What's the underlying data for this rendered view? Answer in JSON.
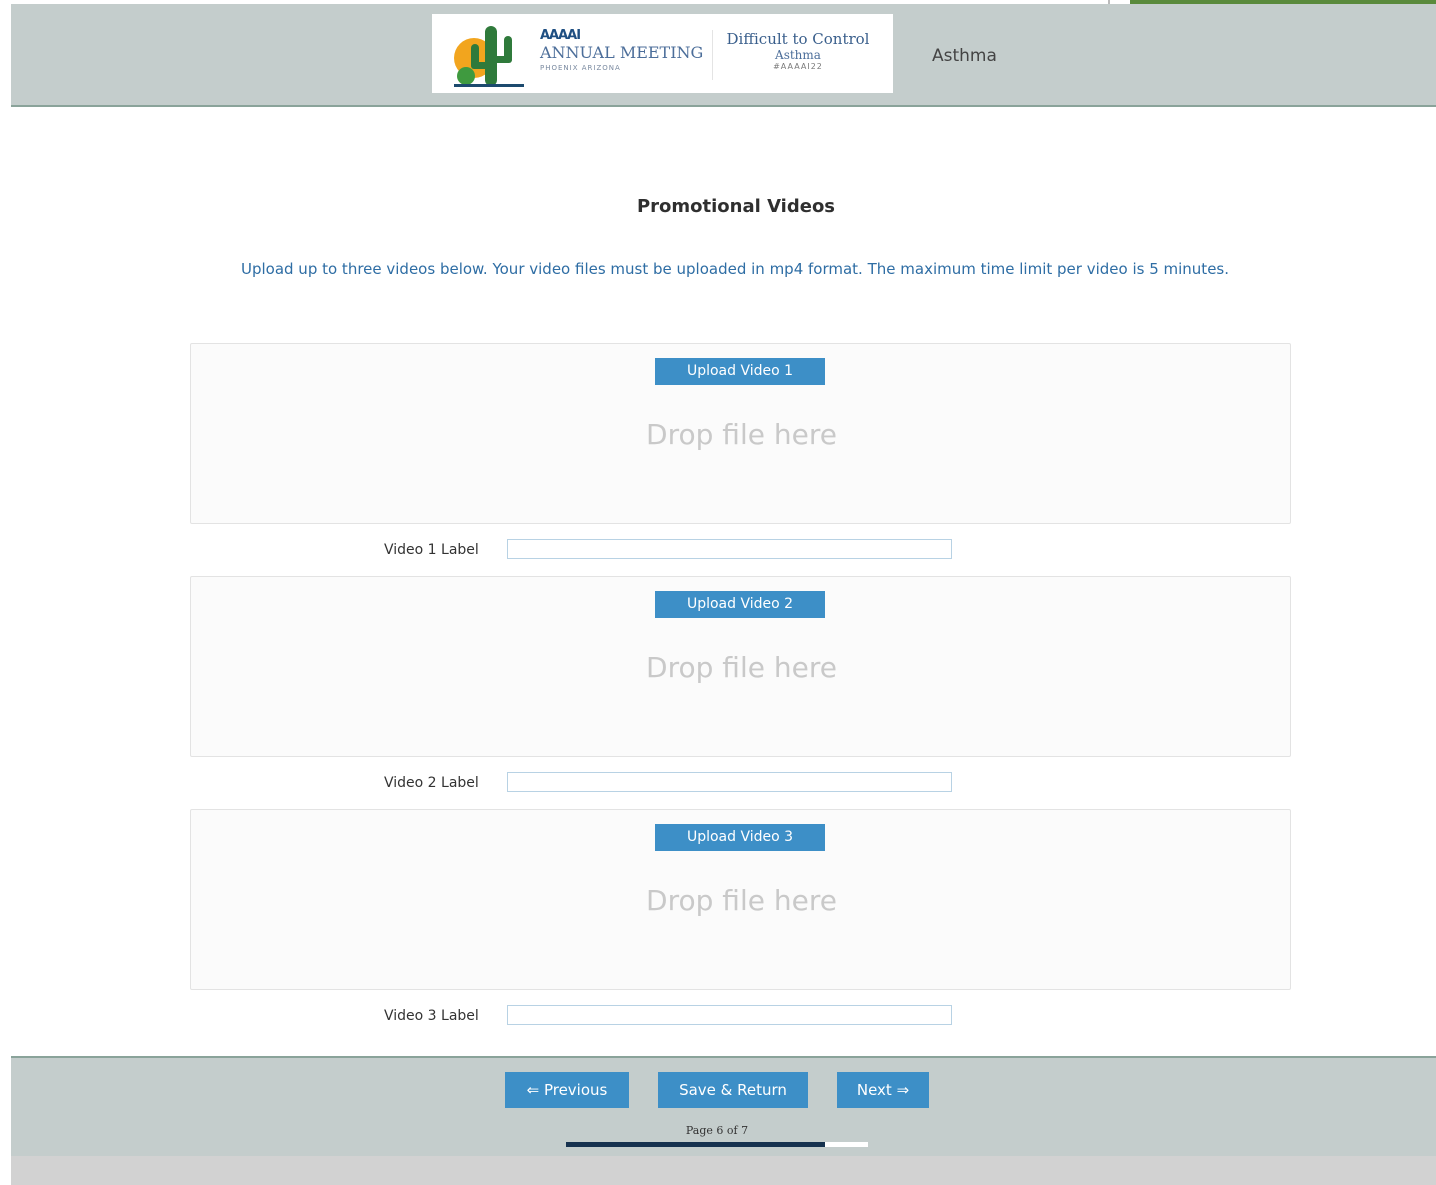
{
  "header": {
    "logo": {
      "org": "AAAAI",
      "meeting": "ANNUAL MEETING",
      "tagline": "PHOENIX ARIZONA",
      "event_line1": "Difficult to Control",
      "event_line2": "Asthma",
      "event_line3": "#AAAAI22"
    },
    "title": "Asthma"
  },
  "main": {
    "title": "Promotional Videos",
    "instructions": "Upload up to three videos below. Your video files must be uploaded in mp4 format. The maximum time limit per video is 5 minutes.",
    "uploads": [
      {
        "button": "Upload Video 1",
        "drop_text": "Drop file here",
        "label": "Video 1 Label",
        "value": ""
      },
      {
        "button": "Upload Video 2",
        "drop_text": "Drop file here",
        "label": "Video 2 Label",
        "value": ""
      },
      {
        "button": "Upload Video 3",
        "drop_text": "Drop file here",
        "label": "Video 3 Label",
        "value": ""
      }
    ]
  },
  "footer": {
    "prev": "⇐ Previous",
    "save": "Save & Return",
    "next": "Next ⇒",
    "page_indicator": "Page 6 of 7",
    "progress": 0.857
  },
  "colors": {
    "header_bg": "#c4cdcc",
    "button": "#3d8fc7",
    "instructions": "#2e6da4",
    "progress_fill": "#16324f"
  }
}
